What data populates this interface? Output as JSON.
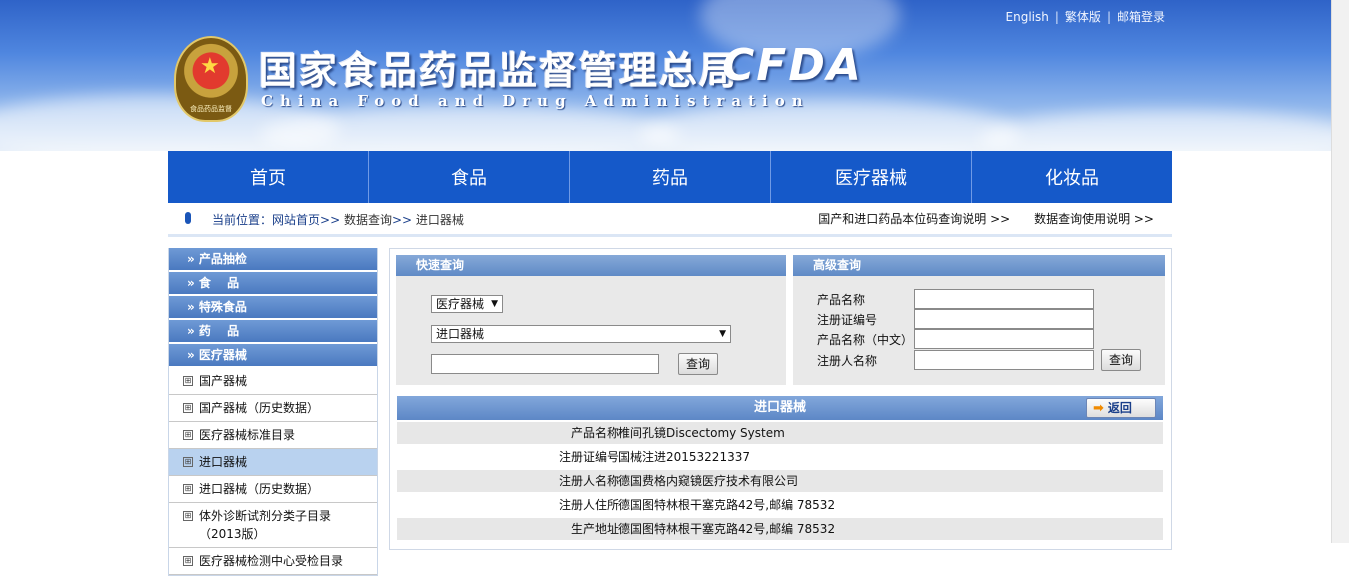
{
  "header": {
    "top_links": [
      "English",
      "繁体版",
      "邮箱登录"
    ],
    "site_title": "国家食品药品监督管理总局",
    "site_en": "China Food and Drug Administration",
    "site_abbr": "CFDA",
    "emblem_label": "食品药品监督"
  },
  "nav": {
    "items": [
      "首页",
      "食品",
      "药品",
      "医疗器械",
      "化妆品"
    ]
  },
  "breadcrumb": {
    "prefix": "当前位置：",
    "home": "网站首页",
    "level2": "数据查询",
    "current": "进口器械",
    "sep": ">>",
    "right_links": [
      "国产和进口药品本位码查询说明 >>",
      "数据查询使用说明 >>"
    ]
  },
  "sidebar": {
    "headers": [
      "» 产品抽检",
      "» 食　 品",
      "» 特殊食品",
      "» 药　 品",
      "» 医疗器械"
    ],
    "items": [
      "国产器械",
      "国产器械（历史数据）",
      "医疗器械标准目录",
      "进口器械",
      "进口器械（历史数据）",
      "体外诊断试剂分类子目录（2013版）",
      "医疗器械检测中心受检目录"
    ],
    "expand_icon": "⊞"
  },
  "quick_search": {
    "title": "快速查询",
    "category_select": "医疗器械",
    "subcategory_select": "进口器械",
    "keyword_value": "",
    "query_label": "查询"
  },
  "advanced_search": {
    "title": "高级查询",
    "fields": [
      "产品名称",
      "注册证编号",
      "产品名称（中文）",
      "注册人名称"
    ],
    "query_label": "查询"
  },
  "result": {
    "title": "进口器械",
    "back_label": "返回",
    "rows": [
      {
        "k": "产品名称",
        "v": "椎间孔镜Discectomy System"
      },
      {
        "k": "注册证编号",
        "v": "国械注进20153221337"
      },
      {
        "k": "注册人名称",
        "v": "德国费格内窥镜医疗技术有限公司"
      },
      {
        "k": "注册人住所",
        "v": "德国图特林根干塞克路42号,邮编 78532"
      },
      {
        "k": "生产地址",
        "v": "德国图特林根干塞克路42号,邮编 78532"
      }
    ]
  }
}
